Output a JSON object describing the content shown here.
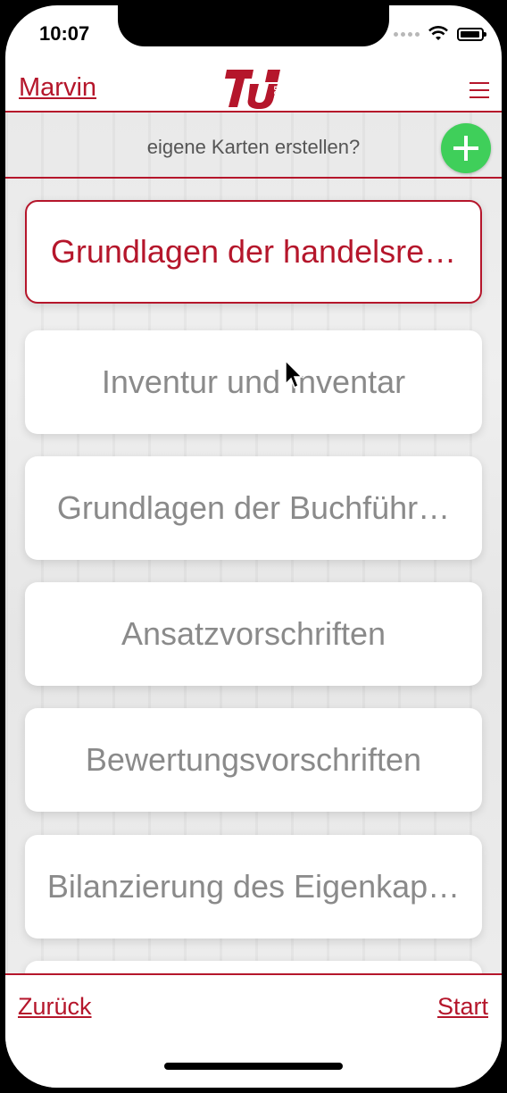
{
  "status": {
    "time": "10:07"
  },
  "header": {
    "user": "Marvin"
  },
  "subheader": {
    "prompt": "eigene Karten erstellen?"
  },
  "topics": [
    {
      "label": "Grundlagen der handelsre…",
      "active": true
    },
    {
      "label": "Inventur und Inventar",
      "active": false
    },
    {
      "label": "Grundlagen der Buchführ…",
      "active": false
    },
    {
      "label": "Ansatzvorschriften",
      "active": false
    },
    {
      "label": "Bewertungsvorschriften",
      "active": false
    },
    {
      "label": "Bilanzierung des Eigenkap…",
      "active": false
    }
  ],
  "footer": {
    "back": "Zurück",
    "start": "Start"
  },
  "icons": {
    "logo": "tu-berlin-logo",
    "menu": "hamburger-menu-icon",
    "add": "plus-icon"
  },
  "colors": {
    "accent": "#b5162b",
    "add": "#3fcf5a",
    "text": "#8a8a8a"
  }
}
